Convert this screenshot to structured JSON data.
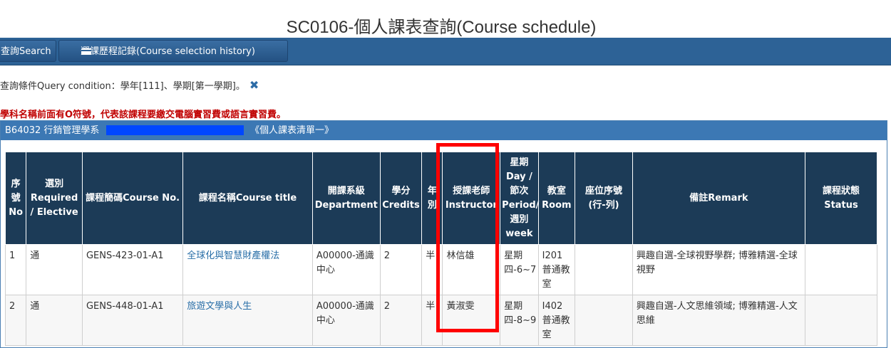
{
  "page": {
    "title": "SC0106-個人課表查詢(Course schedule)"
  },
  "toolbar": {
    "search_label": "查詢Search",
    "history_label": "選課歷程記錄(Course selection history)"
  },
  "query": {
    "text": "查詢條件Query condition：學年[111]、學期[第一學期]。"
  },
  "notice": {
    "text": "學科名稱前面有O符號，代表該課程要繳交電腦實習費或語言實習費。"
  },
  "panel": {
    "student_code": "B64032 行銷管理學系",
    "list_label": "《個人課表清單一》"
  },
  "table": {
    "headers": {
      "no": "序號No",
      "type": "選別Required / Elective",
      "code": "課程簡碼Course No.",
      "title": "課程名稱Course title",
      "dept": "開課系級Department",
      "credits": "學分Credits",
      "year": "年別",
      "instructor": "授課老師Instructor",
      "period": "星期Day / 節次Period/週別week",
      "room": "教室Room",
      "seat": "座位序號(行-列)",
      "remark": "備註Remark",
      "status": "課程狀態Status"
    },
    "rows": [
      {
        "no": "1",
        "type": "通",
        "code": "GENS-423-01-A1",
        "title": "全球化與智慧財產權法",
        "dept": "A00000-通識中心",
        "credits": "2",
        "year": "半",
        "instructor": "林信雄",
        "period": "星期四-6~7",
        "room": "I201普通教室",
        "seat": "",
        "remark": "興趣自選-全球視野學群; 博雅精選-全球視野",
        "status": ""
      },
      {
        "no": "2",
        "type": "通",
        "code": "GENS-448-01-A1",
        "title": "旅遊文學與人生",
        "dept": "A00000-通識中心",
        "credits": "2",
        "year": "半",
        "instructor": "黃淑雯",
        "period": "星期四-8~9",
        "room": "I402普通教室",
        "seat": "",
        "remark": "興趣自選-人文思維領域; 博雅精選-人文思維",
        "status": ""
      }
    ]
  },
  "colors": {
    "toolbar": "#2d6296",
    "table_header": "#1c3b57",
    "panel_header": "#3c78b4",
    "warning": "#c00000",
    "highlight": "#ff0000",
    "link": "#2a6fa8"
  }
}
